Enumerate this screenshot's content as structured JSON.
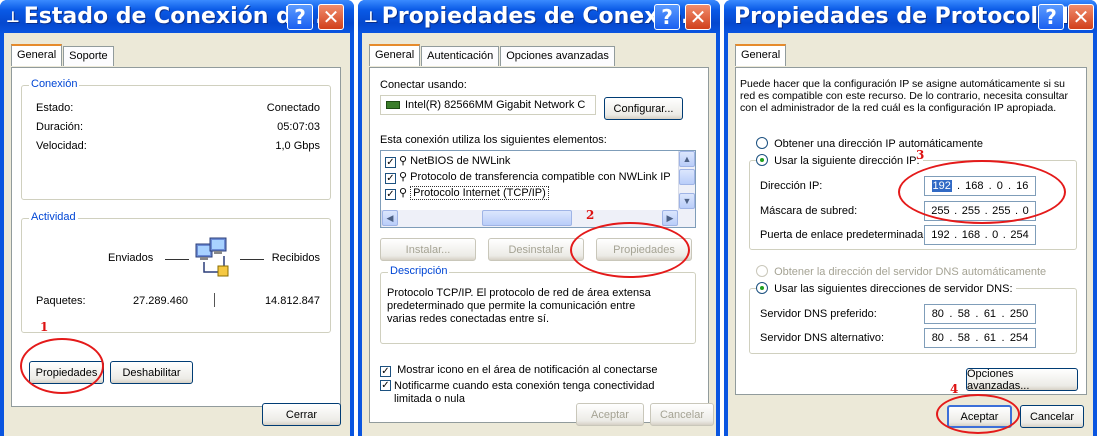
{
  "window1": {
    "title": "Estado de Conexión de...",
    "tabs": [
      "General",
      "Soporte"
    ],
    "connection": {
      "legend": "Conexión",
      "rows": [
        {
          "label": "Estado:",
          "value": "Conectado"
        },
        {
          "label": "Duración:",
          "value": "05:07:03"
        },
        {
          "label": "Velocidad:",
          "value": "1,0 Gbps"
        }
      ]
    },
    "activity": {
      "legend": "Actividad",
      "sent_label": "Enviados",
      "received_label": "Recibidos",
      "packets_label": "Paquetes:",
      "packets_sent": "27.289.460",
      "packets_received": "14.812.847"
    },
    "properties_button": "Propiedades",
    "disable_button": "Deshabilitar",
    "close_button": "Cerrar",
    "annotation": "1"
  },
  "window2": {
    "title": "Propiedades de Conexió...",
    "tabs": [
      "General",
      "Autenticación",
      "Opciones avanzadas"
    ],
    "connect_using_label": "Conectar usando:",
    "adapter_name": "Intel(R) 82566MM Gigabit Network C",
    "configure_button": "Configurar...",
    "elements_label": "Esta conexión utiliza los siguientes elementos:",
    "elements": [
      {
        "label": "NetBIOS de NWLink"
      },
      {
        "label": "Protocolo de transferencia compatible con NWLink IP"
      },
      {
        "label": "Protocolo Internet (TCP/IP)"
      }
    ],
    "install_button": "Instalar...",
    "uninstall_button": "Desinstalar",
    "properties_button": "Propiedades",
    "description_legend": "Descripción",
    "description_text": "Protocolo TCP/IP. El protocolo de red de área extensa predeterminado que permite la comunicación entre varias redes conectadas entre sí.",
    "show_icon_label": "Mostrar icono en el área de notificación al conectarse",
    "notify_label": "Notificarme cuando esta conexión tenga conectividad limitada o nula",
    "accept_button": "Aceptar",
    "cancel_button": "Cancelar",
    "annotation": "2"
  },
  "window3": {
    "title": "Propiedades de Protocolo I...",
    "tabs": [
      "General"
    ],
    "intro": "Puede hacer que la configuración IP se asigne automáticamente si su red es compatible con este recurso. De lo contrario, necesita consultar con el administrador de la red cuál es la configuración IP apropiada.",
    "auto_ip_label": "Obtener una dirección IP automáticamente",
    "manual_ip_label": "Usar la siguiente dirección IP:",
    "ip_label": "Dirección IP:",
    "ip_value": [
      "192",
      "168",
      "0",
      "16"
    ],
    "mask_label": "Máscara de subred:",
    "mask_value": [
      "255",
      "255",
      "255",
      "0"
    ],
    "gateway_label": "Puerta de enlace predeterminada:",
    "gateway_value": [
      "192",
      "168",
      "0",
      "254"
    ],
    "auto_dns_label": "Obtener la dirección del servidor DNS automáticamente",
    "manual_dns_label": "Usar las siguientes direcciones de servidor DNS:",
    "dns1_label": "Servidor DNS preferido:",
    "dns1_value": [
      "80",
      "58",
      "61",
      "250"
    ],
    "dns2_label": "Servidor DNS alternativo:",
    "dns2_value": [
      "80",
      "58",
      "61",
      "254"
    ],
    "advanced_button": "Opciones avanzadas...",
    "accept_button": "Aceptar",
    "cancel_button": "Cancelar",
    "annotation_ip": "3",
    "annotation_accept": "4"
  },
  "title_buttons": {
    "help": "?",
    "close": "✕"
  },
  "colors": {
    "titlebar": "#0a55e0",
    "dialog_bg": "#ece9d8",
    "annotation": "#e41a1a"
  }
}
